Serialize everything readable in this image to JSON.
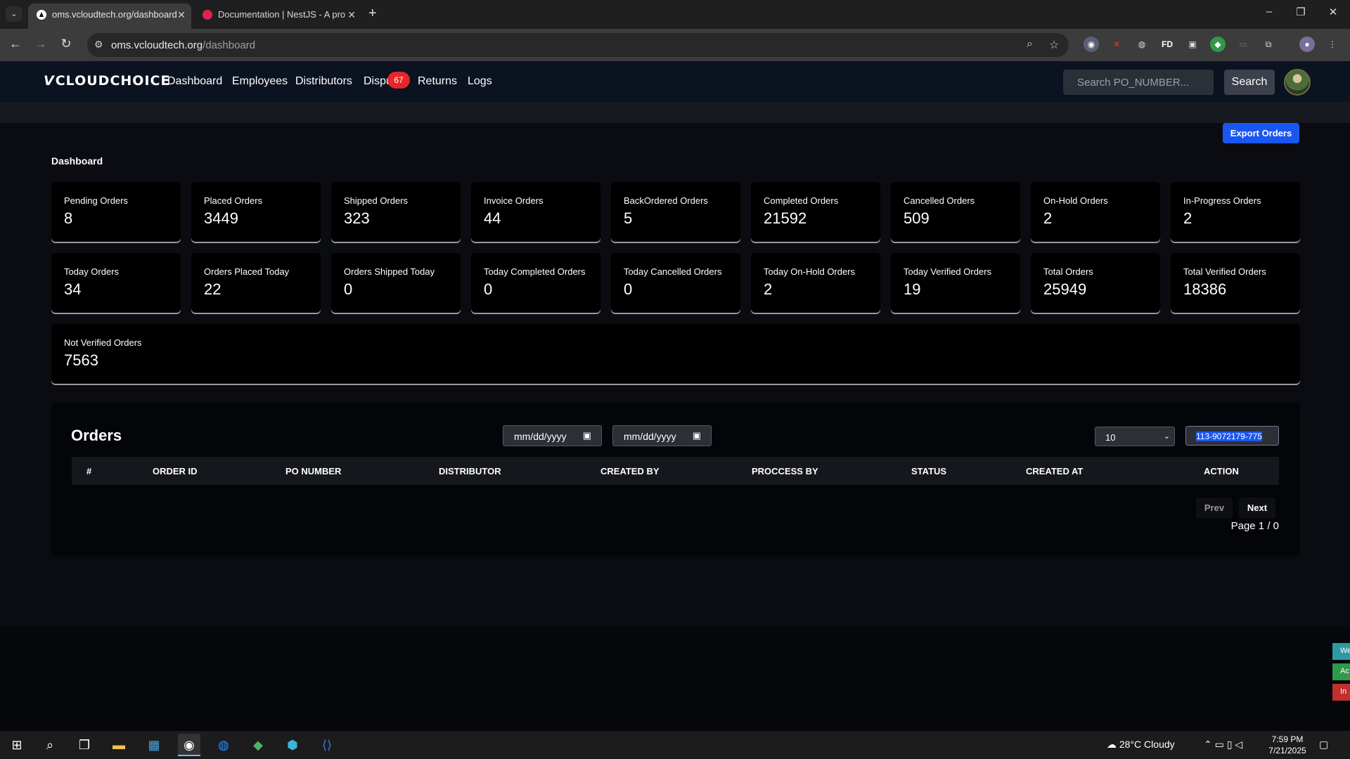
{
  "browser": {
    "tabs": [
      {
        "title": "oms.vcloudtech.org/dashboard",
        "active": true
      },
      {
        "title": "Documentation | NestJS - A pro",
        "active": false
      }
    ],
    "url_host": "oms.vcloudtech.org",
    "url_path": "/dashboard",
    "extensions": [
      "glasses-icon",
      "x-icon",
      "globe-icon",
      "FD",
      "image-icon",
      "shield-icon",
      "screen-icon",
      "puzzle-icon",
      "profile-icon",
      "menu-icon"
    ]
  },
  "header": {
    "logo": "CLOUDCHOICE",
    "nav": [
      "Dashboard",
      "Employees",
      "Distributors",
      "Dispu",
      "Returns",
      "Logs"
    ],
    "disputes_badge": "67",
    "search_placeholder": "Search PO_NUMBER...",
    "search_button": "Search"
  },
  "main": {
    "export_button": "Export Orders",
    "page_title": "Dashboard",
    "stats_row1": [
      {
        "label": "Pending Orders",
        "value": "8"
      },
      {
        "label": "Placed Orders",
        "value": "3449"
      },
      {
        "label": "Shipped Orders",
        "value": "323"
      },
      {
        "label": "Invoice Orders",
        "value": "44"
      },
      {
        "label": "BackOrdered Orders",
        "value": "5"
      },
      {
        "label": "Completed Orders",
        "value": "21592"
      },
      {
        "label": "Cancelled Orders",
        "value": "509"
      },
      {
        "label": "On-Hold Orders",
        "value": "2"
      },
      {
        "label": "In-Progress Orders",
        "value": "2"
      }
    ],
    "stats_row2": [
      {
        "label": "Today Orders",
        "value": "34"
      },
      {
        "label": "Orders Placed Today",
        "value": "22"
      },
      {
        "label": "Orders Shipped Today",
        "value": "0"
      },
      {
        "label": "Today Completed Orders",
        "value": "0"
      },
      {
        "label": "Today Cancelled Orders",
        "value": "0"
      },
      {
        "label": "Today On-Hold Orders",
        "value": "2"
      },
      {
        "label": "Today Verified Orders",
        "value": "19"
      },
      {
        "label": "Total Orders",
        "value": "25949"
      },
      {
        "label": "Total Verified Orders",
        "value": "18386"
      }
    ],
    "not_verified": {
      "label": "Not Verified Orders",
      "value": "7563"
    }
  },
  "orders": {
    "title": "Orders",
    "date_from_placeholder": "mm/dd/yyyy",
    "date_to_placeholder": "mm/dd/yyyy",
    "page_size": "10",
    "search_value": "113-9072179-775",
    "columns": [
      "#",
      "ORDER ID",
      "PO NUMBER",
      "DISTRIBUTOR",
      "CREATED BY",
      "PROCCESS BY",
      "STATUS",
      "CREATED AT",
      "ACTION"
    ],
    "prev_label": "Prev",
    "next_label": "Next",
    "page_info": "Page 1 / 0"
  },
  "side_tabs": [
    {
      "text": "We",
      "color": "#2e9aa3"
    },
    {
      "text": "Ac",
      "color": "#2f9a49"
    },
    {
      "text": "In",
      "color": "#c0302c"
    }
  ],
  "taskbar": {
    "weather": "28°C  Cloudy",
    "time": "7:59 PM",
    "date": "7/21/2025"
  }
}
